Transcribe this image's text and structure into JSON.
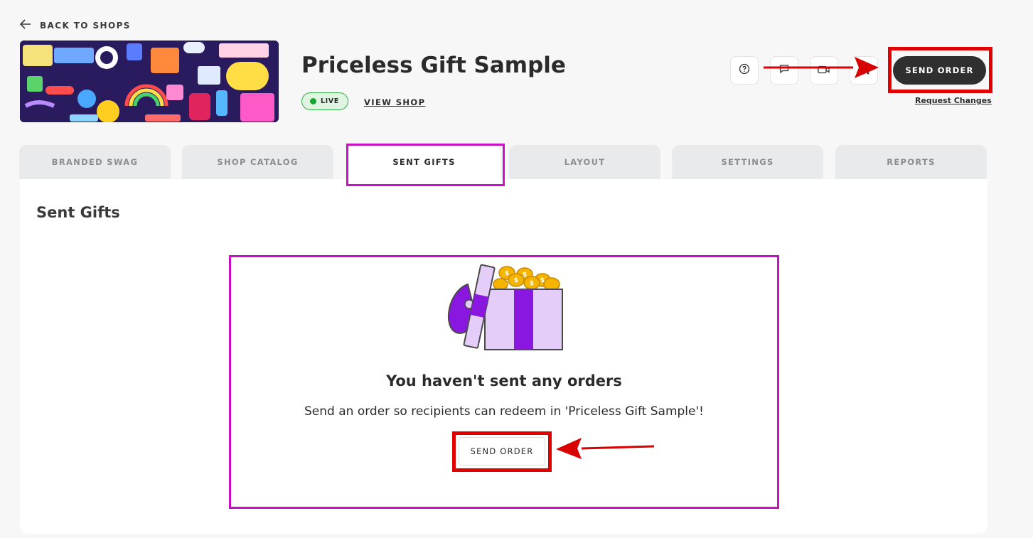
{
  "nav": {
    "back_label": "BACK TO SHOPS"
  },
  "shop": {
    "title": "Priceless Gift Sample",
    "status_label": "LIVE",
    "view_shop_label": "VIEW SHOP"
  },
  "header_actions": {
    "icons": [
      "help-circle-icon",
      "chat-icon",
      "video-icon",
      "more-icon"
    ],
    "send_order_label": "SEND ORDER",
    "request_changes_label": "Request Changes"
  },
  "tabs": [
    {
      "label": "BRANDED SWAG",
      "active": false
    },
    {
      "label": "SHOP CATALOG",
      "active": false
    },
    {
      "label": "SENT GIFTS",
      "active": true
    },
    {
      "label": "LAYOUT",
      "active": false
    },
    {
      "label": "SETTINGS",
      "active": false
    },
    {
      "label": "REPORTS",
      "active": false
    }
  ],
  "panel": {
    "title": "Sent Gifts",
    "empty_state": {
      "title": "You haven't sent any orders",
      "subtitle": "Send an order so recipients can redeem in 'Priceless Gift Sample'!",
      "button_label": "SEND ORDER"
    }
  },
  "colors": {
    "primary_button": "#2f2f2f",
    "live_green": "#18a52f",
    "annotation_red": "#e00000",
    "annotation_magenta": "#cc0ec5",
    "gift_purple": "#8a17e0",
    "gift_lavender": "#e4cdf9",
    "coin_gold": "#f5b400"
  }
}
